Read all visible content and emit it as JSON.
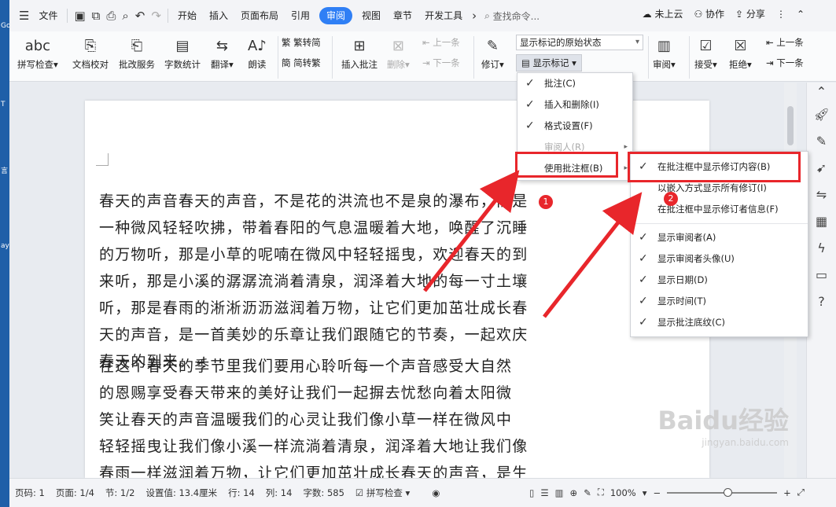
{
  "desktop": {
    "edge_labels": [
      "Go",
      "T",
      "言",
      "ay"
    ]
  },
  "menubar": {
    "file": "文件",
    "tabs": [
      "开始",
      "插入",
      "页面布局",
      "引用",
      "审阅",
      "视图",
      "章节",
      "开发工具"
    ],
    "active_tab": "审阅",
    "search": "查找命令...",
    "cloud": "未上云",
    "collab": "协作",
    "share": "分享"
  },
  "ribbon": {
    "spell": "拼写检查",
    "proof": "文档校对",
    "review_service": "批改服务",
    "word_count": "字数统计",
    "translate": "翻译",
    "read": "朗读",
    "trad": "繁转简",
    "simp": "简转繁",
    "insert_comment": "插入批注",
    "delete": "删除",
    "prev": "上一条",
    "next": "下一条",
    "track": "修订",
    "display_state": "显示标记的原始状态",
    "show_markup": "显示标记",
    "review": "审阅",
    "accept": "接受",
    "reject": "拒绝",
    "prev2": "上一条",
    "next2": "下一条"
  },
  "document": {
    "para1": [
      "春天的声音春天的声音，不是花的洪流也不是泉的瀑布，而是",
      "一种微风轻轻吹拂，带着春阳的气息温暖着大地，唤醒了沉睡",
      "的万物听，那是小草的呢喃在微风中轻轻摇曳，欢迎春天的到",
      "来听，那是小溪的潺潺流淌着清泉，润泽着大地的每一寸土壤",
      "听，那是春雨的淅淅沥沥滋润着万物，让它们更加茁壮成长春",
      "天的声音，是一首美妙的乐章让我们跟随它的节奏，一起欢庆",
      "春天的到来。↵"
    ],
    "para2": [
      "在这个春天的季节里我们要用心聆听每一个声音感受大自然",
      "的恩赐享受春天带来的美好让我们一起摒去忧愁向着太阳微",
      "笑让春天的声音温暖我们的心灵让我们像小草一样在微风中",
      "轻轻摇曳让我们像小溪一样流淌着清泉，润泽着大地让我们像",
      "春雨一样滋润着万物，让它们更加茁壮成长春天的声音，是生"
    ]
  },
  "menu_show_markup": {
    "items": [
      {
        "label": "批注(C)",
        "checked": true
      },
      {
        "label": "插入和删除(I)",
        "checked": true
      },
      {
        "label": "格式设置(F)",
        "checked": true
      },
      {
        "label": "审阅人(R)",
        "checked": false
      },
      {
        "label": "使用批注框(B)",
        "checked": false
      }
    ]
  },
  "menu_balloons": {
    "top": [
      {
        "label": "在批注框中显示修订内容(B)",
        "checked": true
      },
      {
        "label": "以嵌入方式显示所有修订(I)",
        "checked": false
      },
      {
        "label": "在批注框中显示修订者信息(F)",
        "checked": false
      }
    ],
    "bottom": [
      {
        "label": "显示审阅者(A)",
        "checked": true
      },
      {
        "label": "显示审阅者头像(U)",
        "checked": true
      },
      {
        "label": "显示日期(D)",
        "checked": true
      },
      {
        "label": "显示时间(T)",
        "checked": true
      },
      {
        "label": "显示批注底纹(C)",
        "checked": true
      }
    ]
  },
  "badges": {
    "one": "1",
    "two": "2"
  },
  "status": {
    "page_no": "页码: 1",
    "pages": "页面: 1/4",
    "section": "节: 1/2",
    "setting": "设置值: 13.4厘米",
    "row": "行: 14",
    "col": "列: 14",
    "words": "字数: 585",
    "spell": "拼写检查",
    "zoom": "100%"
  },
  "watermark": {
    "brand": "Baidu经验",
    "url": "jingyan.baidu.com"
  },
  "colors": {
    "accent": "#2f7ff5",
    "highlight": "#e8262b"
  }
}
